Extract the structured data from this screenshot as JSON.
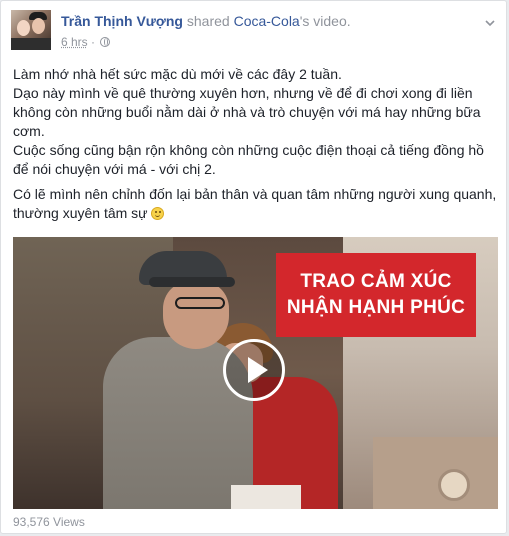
{
  "post": {
    "author": "Trần Thịnh Vượng",
    "action": "shared",
    "page_name": "Coca-Cola",
    "object_suffix": "'s video.",
    "time": "6 hrs",
    "privacy_icon": "globe-icon",
    "menu_icon": "chevron-down-icon"
  },
  "body": {
    "p1_line1": "Làm nhớ nhà hết sức mặc dù mới về các đây 2 tuần.",
    "p1_line2": "Dạo này mình về quê thường xuyên hơn, nhưng về để đi chơi xong đi liền không còn những buổi nằm dài ở nhà và trò chuyện với má hay những bữa cơm.",
    "p1_line3": "Cuộc sống cũng bận rộn không còn những cuộc điện thoại cả tiếng đồng hồ để nói chuyện với má - với chị 2.",
    "p2": "Có lẽ mình nên chỉnh đốn lại bản thân và quan tâm những người xung quanh, thường xuyên tâm sự",
    "emoji": "smile-emoji"
  },
  "video": {
    "banner_line1": "TRAO CẢM XÚC",
    "banner_line2": "NHẬN HẠNH PHÚC",
    "play_icon": "play-icon",
    "banner_color": "#d3272c"
  },
  "stats": {
    "views": "93,576 Views"
  },
  "colors": {
    "link": "#365899",
    "meta": "#90949c",
    "text": "#1d2129"
  }
}
